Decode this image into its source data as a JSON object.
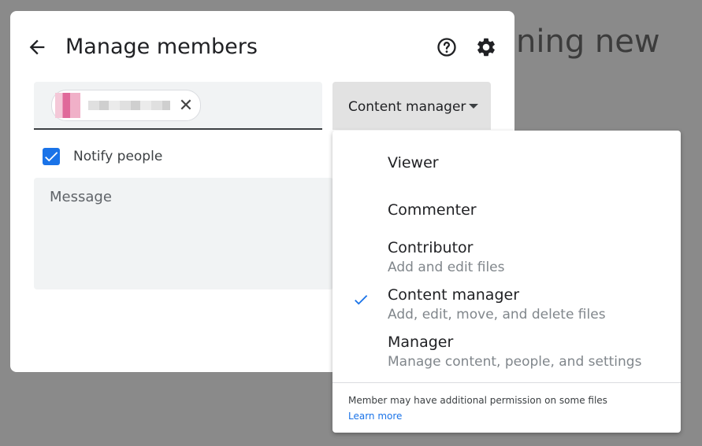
{
  "background": {
    "partial_heading": "ning new"
  },
  "dialog": {
    "title": "Manage members",
    "back_icon": "arrow-back-icon",
    "help_icon": "help-circle-icon",
    "settings_icon": "gear-icon"
  },
  "member_input": {
    "chip_remove_glyph": "✕"
  },
  "role_select": {
    "selected": "Content manager"
  },
  "notify": {
    "label": "Notify people",
    "checked": true
  },
  "message": {
    "placeholder": "Message"
  },
  "role_menu": {
    "items": [
      {
        "label": "Viewer",
        "description": "",
        "selected": false
      },
      {
        "label": "Commenter",
        "description": "",
        "selected": false
      },
      {
        "label": "Contributor",
        "description": "Add and edit files",
        "selected": false
      },
      {
        "label": "Content manager",
        "description": "Add, edit, move, and delete files",
        "selected": true
      },
      {
        "label": "Manager",
        "description": "Manage content, people, and settings",
        "selected": false
      }
    ],
    "footer_note": "Member may have additional permission on some files",
    "footer_link": "Learn more"
  },
  "colors": {
    "accent": "#1a73e8",
    "overlay": "#8a8a8a",
    "field_bg": "#f1f3f4"
  }
}
